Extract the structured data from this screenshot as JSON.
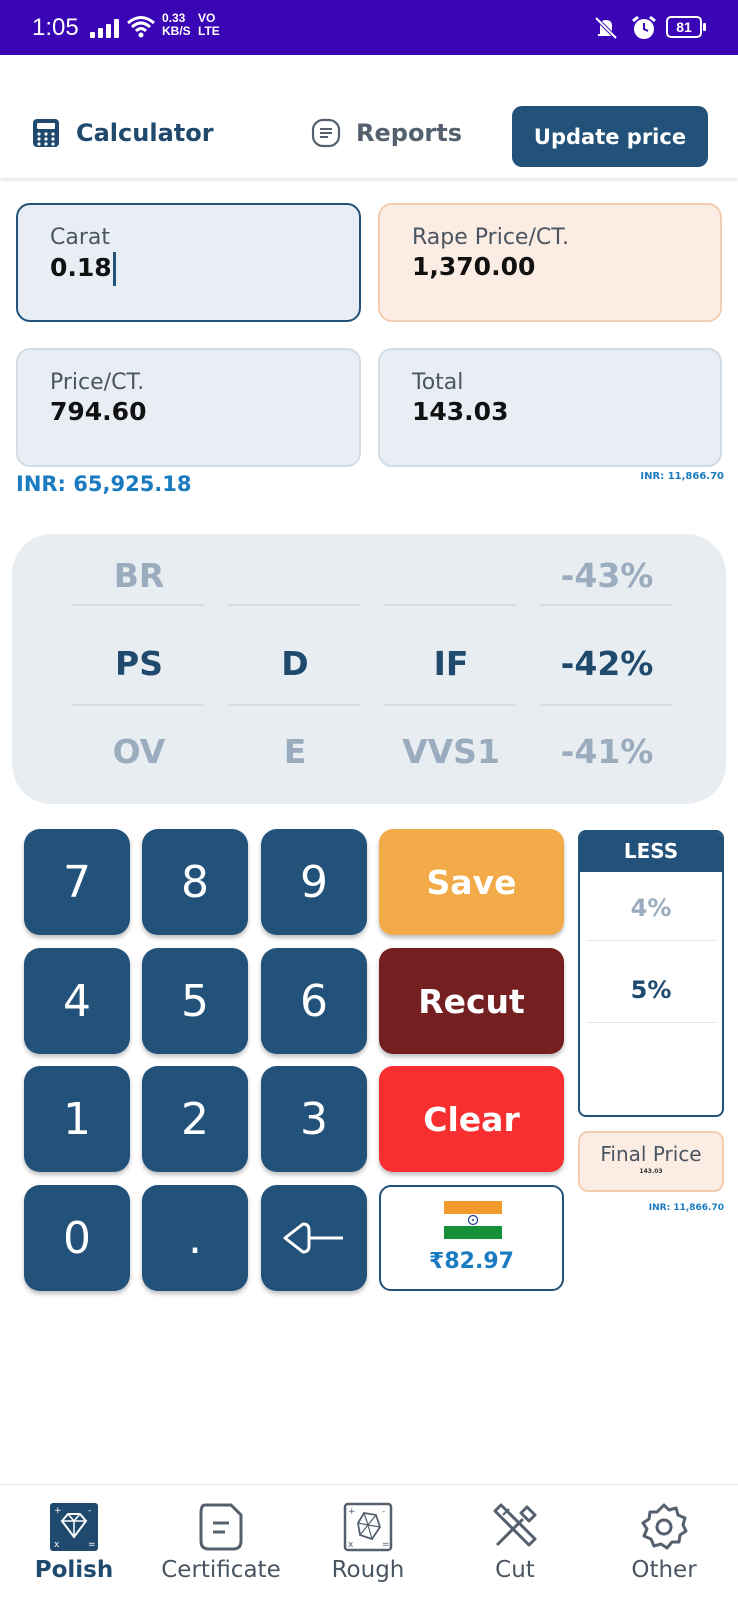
{
  "status_bar": {
    "time": "1:05",
    "net_speed": "0.33",
    "net_unit": "KB/S",
    "net_type_top": "VO",
    "net_type_bottom": "LTE",
    "battery": "81"
  },
  "header": {
    "tabs": [
      {
        "label": "Calculator",
        "icon": "calculator-icon",
        "active": true
      },
      {
        "label": "Reports",
        "icon": "reports-icon",
        "active": false
      }
    ],
    "update_button": "Update price"
  },
  "inputs": {
    "carat": {
      "label": "Carat",
      "value": "0.18"
    },
    "rape_price": {
      "label": "Rape Price/CT.",
      "value": "1,370.00"
    },
    "price_ct": {
      "label": "Price/CT.",
      "value": "794.60"
    },
    "total": {
      "label": "Total",
      "value": "143.03"
    },
    "inr_main": "INR: 65,925.18",
    "inr_total": "INR: 11,866.70"
  },
  "picker": {
    "rows": [
      {
        "shape": "BR",
        "color": "",
        "clarity": "",
        "discount": "-43%",
        "selected": false
      },
      {
        "shape": "PS",
        "color": "D",
        "clarity": "IF",
        "discount": "-42%",
        "selected": true
      },
      {
        "shape": "OV",
        "color": "E",
        "clarity": "VVS1",
        "discount": "-41%",
        "selected": false
      }
    ]
  },
  "keypad": {
    "keys": [
      "7",
      "8",
      "9",
      "4",
      "5",
      "6",
      "1",
      "2",
      "3",
      "0",
      "."
    ],
    "backspace_icon": "backspace-icon"
  },
  "actions": {
    "save": "Save",
    "recut": "Recut",
    "clear": "Clear",
    "currency_rate": "₹82.97",
    "flag_icon": "india-flag-icon"
  },
  "less": {
    "title": "LESS",
    "options": [
      "4%",
      "5%"
    ],
    "selected": "5%"
  },
  "final_price": {
    "label": "Final Price",
    "value": "143.03",
    "inr": "INR: 11,866.70"
  },
  "bottom_nav": [
    {
      "label": "Polish",
      "icon": "diamond-calculator-icon",
      "active": true
    },
    {
      "label": "Certificate",
      "icon": "certificate-icon",
      "active": false
    },
    {
      "label": "Rough",
      "icon": "rough-stone-icon",
      "active": false
    },
    {
      "label": "Cut",
      "icon": "tools-icon",
      "active": false
    },
    {
      "label": "Other",
      "icon": "gear-icon",
      "active": false
    }
  ],
  "colors": {
    "status_bar": "#3a05b4",
    "primary": "#22527a",
    "save": "#f2ab48",
    "recut": "#741f20",
    "clear": "#f72f30",
    "accent_blue": "#1a7bc0"
  }
}
